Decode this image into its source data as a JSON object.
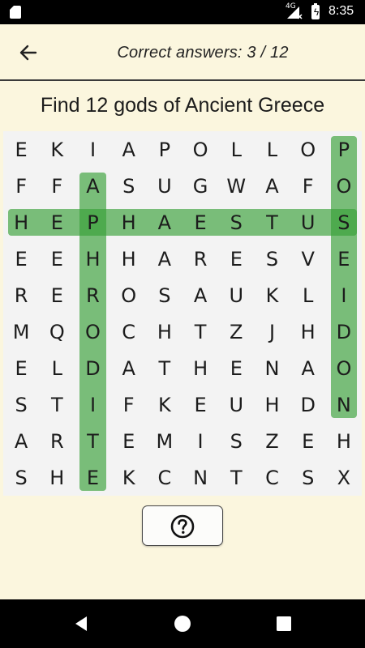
{
  "status_bar": {
    "network": "4G",
    "time": "8:35"
  },
  "header": {
    "title": "Correct answers: 3 / 12"
  },
  "puzzle": {
    "title": "Find 12 gods of Ancient Greece",
    "rows": [
      [
        "E",
        "K",
        "I",
        "A",
        "P",
        "O",
        "L",
        "L",
        "O",
        "P"
      ],
      [
        "F",
        "F",
        "A",
        "S",
        "U",
        "G",
        "W",
        "A",
        "F",
        "O"
      ],
      [
        "H",
        "E",
        "P",
        "H",
        "A",
        "E",
        "S",
        "T",
        "U",
        "S"
      ],
      [
        "E",
        "E",
        "H",
        "H",
        "A",
        "R",
        "E",
        "S",
        "V",
        "E"
      ],
      [
        "R",
        "E",
        "R",
        "O",
        "S",
        "A",
        "U",
        "K",
        "L",
        "I"
      ],
      [
        "M",
        "Q",
        "O",
        "C",
        "H",
        "T",
        "Z",
        "J",
        "H",
        "D"
      ],
      [
        "E",
        "L",
        "D",
        "A",
        "T",
        "H",
        "E",
        "N",
        "A",
        "O"
      ],
      [
        "S",
        "T",
        "I",
        "F",
        "K",
        "E",
        "U",
        "H",
        "D",
        "N"
      ],
      [
        "A",
        "R",
        "T",
        "E",
        "M",
        "I",
        "S",
        "Z",
        "E",
        "H"
      ],
      [
        "S",
        "H",
        "E",
        "K",
        "C",
        "N",
        "T",
        "C",
        "S",
        "X"
      ]
    ],
    "found_words": [
      {
        "word": "HEPHAESTUS",
        "direction": "horizontal",
        "row": 2,
        "col_start": 0,
        "col_end": 9
      },
      {
        "word": "APHRODITE",
        "direction": "vertical",
        "col": 2,
        "row_start": 1,
        "row_end": 9
      },
      {
        "word": "POSEIDON",
        "direction": "vertical",
        "col": 9,
        "row_start": 0,
        "row_end": 7
      }
    ],
    "highlight_color": "#38a038"
  },
  "icons": {
    "back": "arrow-left-icon",
    "hint": "help-circle-icon"
  },
  "colors": {
    "background": "#fbf6de",
    "board": "#f3f3f3",
    "text": "#1c1c1c"
  }
}
